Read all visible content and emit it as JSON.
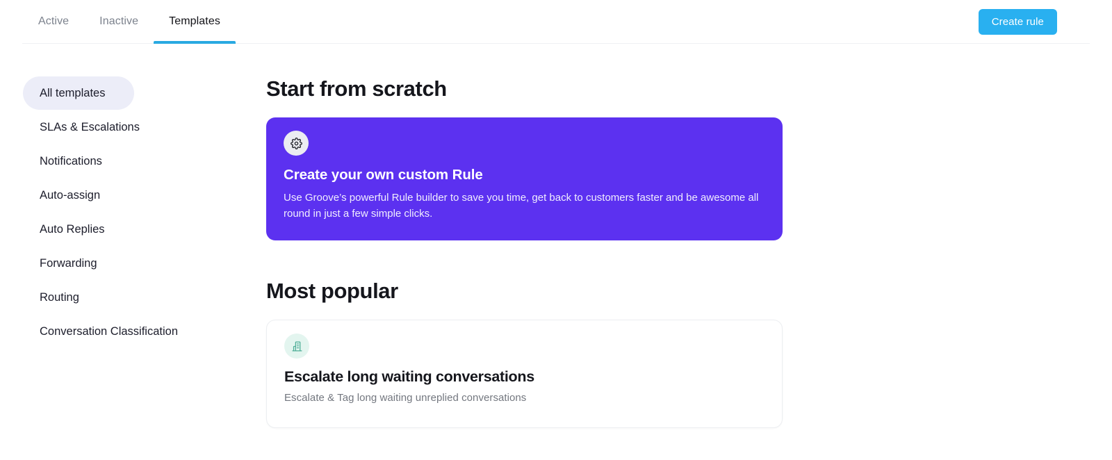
{
  "header": {
    "tabs": [
      {
        "label": "Active",
        "active": false
      },
      {
        "label": "Inactive",
        "active": false
      },
      {
        "label": "Templates",
        "active": true
      }
    ],
    "create_rule_label": "Create rule",
    "accent_color": "#29b0f0",
    "active_tab_underline_color": "#29a9e1"
  },
  "sidebar": {
    "items": [
      {
        "label": "All templates",
        "selected": true
      },
      {
        "label": "SLAs & Escalations",
        "selected": false
      },
      {
        "label": "Notifications",
        "selected": false
      },
      {
        "label": "Auto-assign",
        "selected": false
      },
      {
        "label": "Auto Replies",
        "selected": false
      },
      {
        "label": "Forwarding",
        "selected": false
      },
      {
        "label": "Routing",
        "selected": false
      },
      {
        "label": "Conversation Classification",
        "selected": false
      }
    ],
    "selected_background": "#ecedf8"
  },
  "main": {
    "scratch_section": {
      "heading": "Start from scratch",
      "card": {
        "icon": "gear-icon",
        "title": "Create your own custom Rule",
        "description": "Use Groove’s powerful Rule builder to save you time, get back to customers faster and be awesome all round in just a few simple clicks.",
        "background_color": "#5c31f0"
      }
    },
    "popular_section": {
      "heading": "Most popular",
      "cards": [
        {
          "icon": "building-icon",
          "title": "Escalate long waiting conversations",
          "description": "Escalate & Tag long waiting unreplied conversations",
          "icon_color": "#4fae97",
          "icon_background": "#e3f5ef"
        }
      ]
    }
  }
}
